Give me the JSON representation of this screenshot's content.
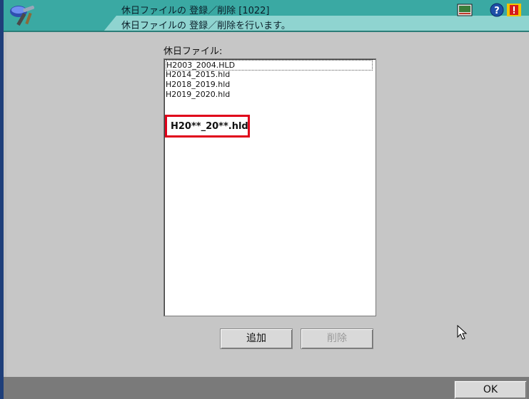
{
  "window": {
    "title": "休日ファイルの 登録／削除 [1022]",
    "subtitle": "休日ファイルの 登録／削除を行います。",
    "icons": [
      "app-tools-icon",
      "terminal-icon",
      "help-icon",
      "alert-icon"
    ]
  },
  "main": {
    "list_label": "休日ファイル:",
    "files": [
      "H2003_2004.HLD",
      "H2014_2015.hld",
      "H2018_2019.hld",
      "H2019_2020.hld"
    ],
    "selected_index": 0,
    "annotation": "H20**_20**.hld",
    "add_label": "追加",
    "delete_label": "削除"
  },
  "footer": {
    "ok_label": "OK"
  },
  "colors": {
    "header": "#3aa9a3",
    "header_strip": "#8fd4d0",
    "annotation_border": "#e0001a"
  }
}
